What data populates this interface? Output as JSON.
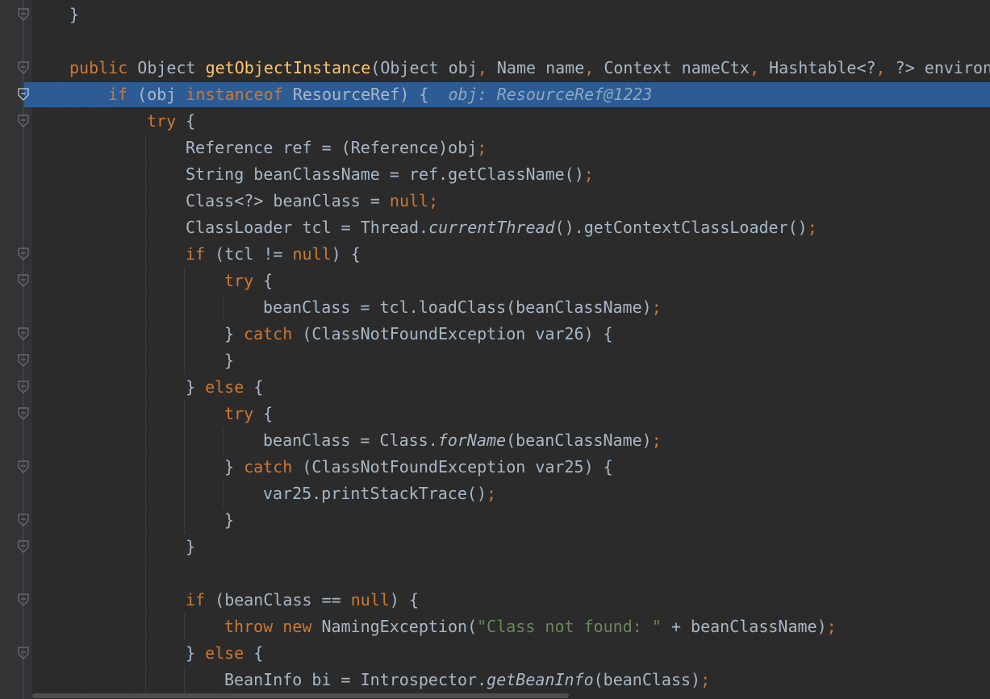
{
  "editor": {
    "language": "java",
    "lines": [
      "}",
      "",
      "public Object getObjectInstance(Object obj, Name name, Context nameCtx, Hashtable<?, ?> environm",
      "if (obj instanceof ResourceRef) {",
      "try {",
      "Reference ref = (Reference)obj;",
      "String beanClassName = ref.getClassName();",
      "Class<?> beanClass = null;",
      "ClassLoader tcl = Thread.currentThread().getContextClassLoader();",
      "if (tcl != null) {",
      "try {",
      "beanClass = tcl.loadClass(beanClassName);",
      "} catch (ClassNotFoundException var26) {",
      "}",
      "} else {",
      "try {",
      "beanClass = Class.forName(beanClassName);",
      "} catch (ClassNotFoundException var25) {",
      "var25.printStackTrace();",
      "}",
      "}",
      "",
      "if (beanClass == null) {",
      "throw new NamingException(\"Class not found: \" + beanClassName);",
      "} else {",
      "BeanInfo bi = Introspector.getBeanInfo(beanClass);"
    ],
    "inline_debug_value": "obj: ResourceRef@1223"
  },
  "colors": {
    "background": "#2b2b2b",
    "gutter": "#313335",
    "execution_line_highlight": "#2d5c95",
    "keyword": "#cc7832",
    "method_declaration": "#ffc66d",
    "string": "#6a8759",
    "default_text": "#a9b7c6"
  },
  "icons": {
    "fold": "fold-marker-icon"
  }
}
